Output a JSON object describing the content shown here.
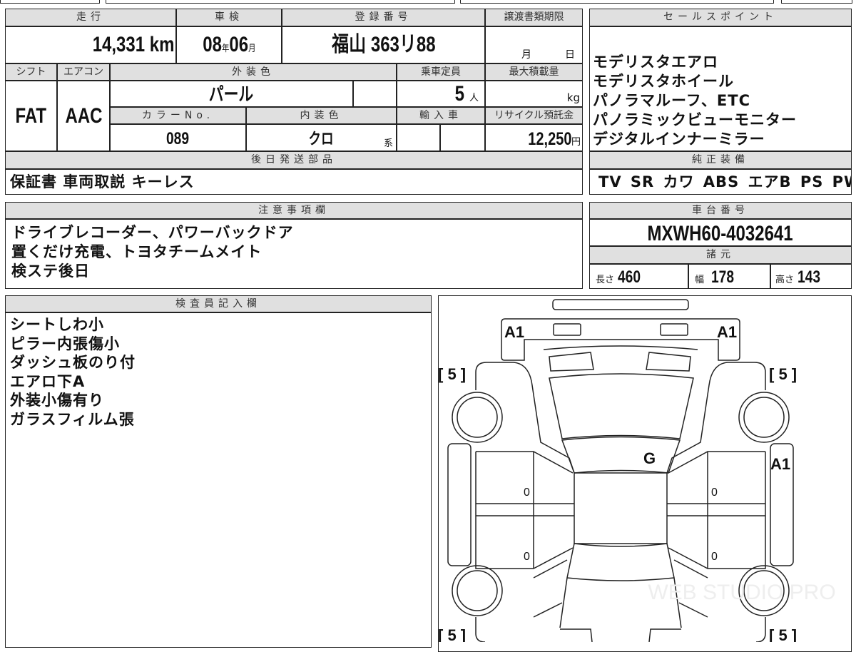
{
  "vehicle": {
    "mileage_label": "走行",
    "mileage_value": "14,331",
    "mileage_unit": "km",
    "inspection_label": "車検",
    "inspection_year": "08",
    "year_unit": "年",
    "inspection_month": "06",
    "month_unit": "月",
    "reg_label": "登録番号",
    "reg_value": "福山 363リ88",
    "transfer_label": "譲渡書類期限",
    "transfer_month": "月",
    "transfer_day": "日",
    "shift_label": "シフト",
    "shift_value": "FAT",
    "ac_label": "エアコン",
    "ac_value": "AAC",
    "ext_color_label": "外装色",
    "ext_color_value": "パール",
    "capacity_label": "乗車定員",
    "capacity_value": "5",
    "capacity_unit": "人",
    "load_label": "最大積載量",
    "load_unit": "kg",
    "color_no_label": "カラーNo.",
    "color_no_value": "089",
    "int_color_label": "内装色",
    "int_color_value": "クロ",
    "int_color_suffix": "系",
    "import_label": "輸入車",
    "recycle_label": "リサイクル預託金",
    "recycle_value": "12,250",
    "recycle_unit": "円",
    "later_parts_label": "後日発送部品",
    "later_parts_value": "保証書 車両取説 キーレス"
  },
  "sales_points": {
    "label": "セールスポイント",
    "items": [
      "モデリスタエアロ",
      "モデリスタホイール",
      "パノラマルーフ、ETC",
      "パノラミックビューモニター",
      "デジタルインナーミラー"
    ]
  },
  "equipment": {
    "label": "純正装備",
    "value": "TV SR カワ ABS エアB PS PW"
  },
  "notes": {
    "label": "注意事項欄",
    "lines": [
      "ドライブレコーダー、パワーバックドア",
      "置くだけ充電、トヨタチームメイト",
      "検ステ後日"
    ]
  },
  "chassis": {
    "label": "車台番号",
    "value": "MXWH60-4032641",
    "spec_label": "諸元",
    "length_label": "長さ",
    "length": "460",
    "width_label": "幅",
    "width": "178",
    "height_label": "高さ",
    "height": "143"
  },
  "inspector": {
    "label": "検査員記入欄",
    "lines": [
      "シートしわ小",
      "ピラー内張傷小",
      "ダッシュ板のり付",
      "エアロ下A",
      "外装小傷有り",
      "ガラスフィルム張"
    ]
  },
  "diagram": {
    "marks": {
      "front_left": "A1",
      "front_right": "A1",
      "right_side": "A1",
      "roof": "G",
      "door_fl": "0",
      "door_rl": "0",
      "door_fr": "0",
      "door_rr": "0",
      "tire_fl": "[ 5 ]",
      "tire_fr": "[ 5 ]",
      "tire_rl": "[ 5 ]",
      "tire_rr": "[ 5 ]"
    },
    "watermark": "WEB STUDIO PRO"
  }
}
